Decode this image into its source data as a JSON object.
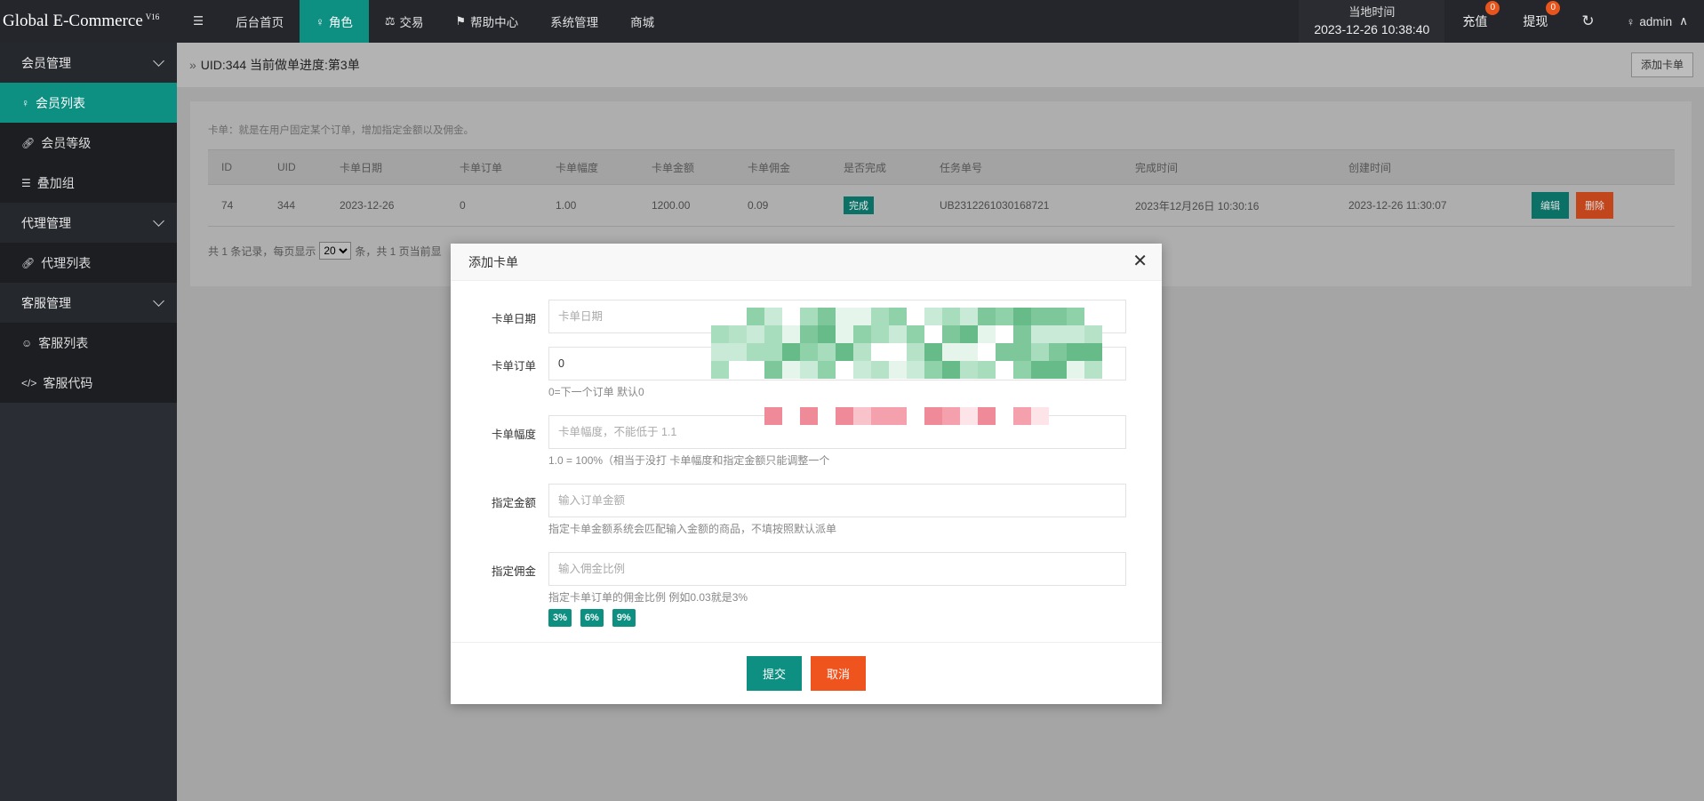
{
  "brand": {
    "name": "Global E-Commerce",
    "version": "V16"
  },
  "topnav": {
    "menu_icon": "☰",
    "items": [
      {
        "label": "后台首页",
        "icon": ""
      },
      {
        "label": "角色",
        "icon": "user-icon",
        "active": true
      },
      {
        "label": "交易",
        "icon": "scale-icon"
      },
      {
        "label": "帮助中心",
        "icon": "flag-icon"
      },
      {
        "label": "系统管理",
        "icon": ""
      },
      {
        "label": "商城",
        "icon": ""
      }
    ],
    "clock_label": "当地时间",
    "clock_value": "2023-12-26 10:38:40",
    "recharge": {
      "label": "充值",
      "count": "0"
    },
    "withdraw": {
      "label": "提现",
      "count": "0"
    },
    "user": "admin"
  },
  "sidebar": {
    "groups": [
      {
        "label": "会员管理",
        "items": [
          {
            "label": "会员列表",
            "icon": "user-icon",
            "active": true
          },
          {
            "label": "会员等级",
            "icon": "link-icon"
          },
          {
            "label": "叠加组",
            "icon": "list-icon"
          }
        ]
      },
      {
        "label": "代理管理",
        "items": [
          {
            "label": "代理列表",
            "icon": "link-icon"
          }
        ]
      },
      {
        "label": "客服管理",
        "items": [
          {
            "label": "客服列表",
            "icon": "users-icon"
          },
          {
            "label": "客服代码",
            "icon": "code-icon"
          }
        ]
      }
    ]
  },
  "breadcrumb": {
    "text": "UID:344 当前做单进度:第3单"
  },
  "add_card_button": "添加卡单",
  "panel": {
    "intro": "卡单：就是在用户固定某个订单，增加指定金额以及佣金。",
    "columns": [
      "ID",
      "UID",
      "卡单日期",
      "卡单订单",
      "卡单幅度",
      "卡单金额",
      "卡单佣金",
      "是否完成",
      "任务单号",
      "完成时间",
      "创建时间",
      ""
    ],
    "rows": [
      {
        "id": "74",
        "uid": "344",
        "date": "2023-12-26",
        "order": "0",
        "range": "1.00",
        "amount": "1200.00",
        "commission": "0.09",
        "status": "完成",
        "task_no": "UB2312261030168721",
        "done_time": "2023年12月26日 10:30:16",
        "created": "2023-12-26 11:30:07",
        "edit": "编辑",
        "delete": "删除"
      }
    ],
    "pager": {
      "prefix": "共 1 条记录，每页显示",
      "per_page": "20",
      "suffix": "条，共 1 页当前显"
    }
  },
  "modal": {
    "title": "添加卡单",
    "fields": {
      "date": {
        "label": "卡单日期",
        "placeholder": "卡单日期"
      },
      "order": {
        "label": "卡单订单",
        "value": "0",
        "hint": "0=下一个订单 默认0"
      },
      "range": {
        "label": "卡单幅度",
        "placeholder": "卡单幅度，不能低于 1.1",
        "hint": "1.0 = 100%（相当于没打 卡单幅度和指定金额只能调整一个"
      },
      "amount": {
        "label": "指定金额",
        "placeholder": "输入订单金额",
        "hint": "指定卡单金额系统会匹配输入金额的商品，不填按照默认派单"
      },
      "commission": {
        "label": "指定佣金",
        "placeholder": "输入佣金比例",
        "hint": "指定卡单订单的佣金比例 例如0.03就是3%"
      }
    },
    "chips": [
      "3%",
      "6%",
      "9%"
    ],
    "submit": "提交",
    "cancel": "取消"
  },
  "colors": {
    "accent": "#0d8f82",
    "danger": "#f0541e",
    "topbar": "#24262b",
    "sidebar": "#2a2d33"
  }
}
